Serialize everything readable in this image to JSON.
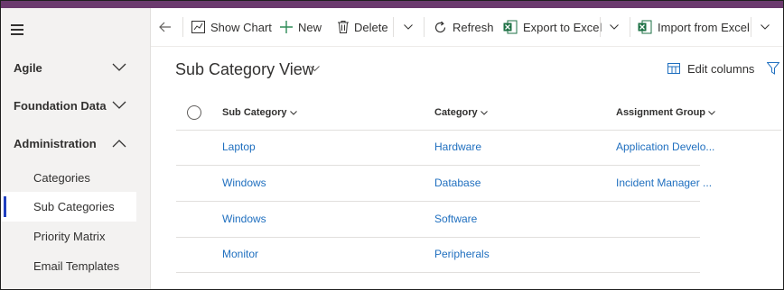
{
  "sidebar": {
    "groups": [
      {
        "label": "Agile"
      },
      {
        "label": "Foundation Data"
      },
      {
        "label": "Administration"
      }
    ],
    "items": [
      {
        "label": "Categories"
      },
      {
        "label": "Sub Categories",
        "active": true
      },
      {
        "label": "Priority Matrix"
      },
      {
        "label": "Email Templates"
      }
    ]
  },
  "toolbar": {
    "show_chart": "Show Chart",
    "new": "New",
    "delete": "Delete",
    "refresh": "Refresh",
    "export_excel": "Export to Excel",
    "import_excel": "Import from Excel"
  },
  "view": {
    "title": "Sub Category View",
    "edit_columns": "Edit columns"
  },
  "grid": {
    "columns": [
      "Sub Category",
      "Category",
      "Assignment Group"
    ],
    "rows": [
      {
        "sub_category": "Laptop",
        "category": "Hardware",
        "assignment_group": "Application Develo..."
      },
      {
        "sub_category": "Windows",
        "category": "Database",
        "assignment_group": "Incident Manager ..."
      },
      {
        "sub_category": "Windows",
        "category": "Software",
        "assignment_group": ""
      },
      {
        "sub_category": "Monitor",
        "category": "Peripherals",
        "assignment_group": ""
      }
    ]
  },
  "colors": {
    "top_bar": "#6b3a6e",
    "link": "#1f6fbf",
    "active_indicator": "#1f3fbf",
    "excel_green": "#1e7145"
  }
}
